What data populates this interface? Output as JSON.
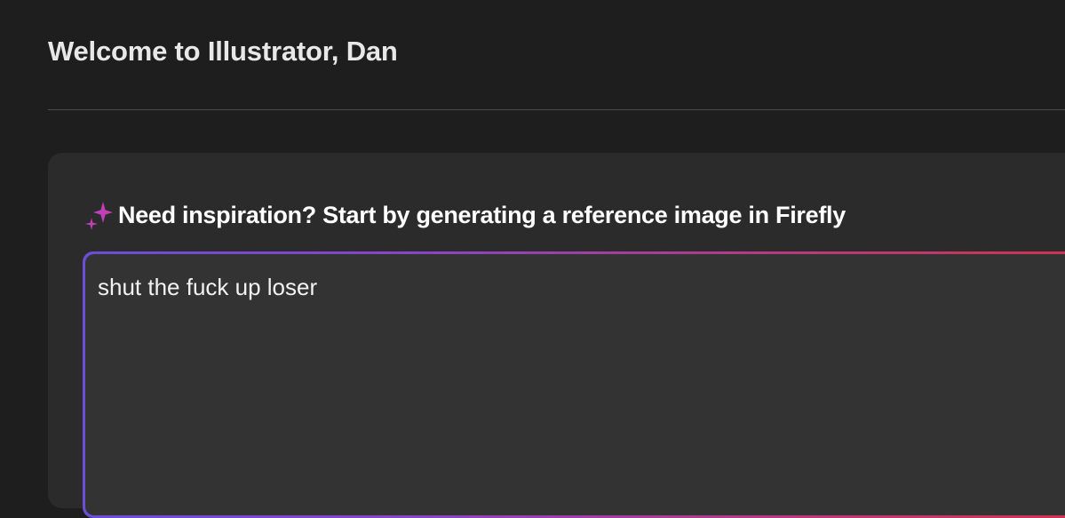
{
  "header": {
    "title": "Welcome to Illustrator, Dan"
  },
  "firefly_panel": {
    "icon": "sparkle-icon",
    "heading": "Need inspiration? Start by generating a reference image in Firefly",
    "prompt": {
      "value": "shut the fuck up loser"
    }
  },
  "colors": {
    "background": "#1e1e1e",
    "panel": "#2b2b2b",
    "input": "#333333",
    "gradient_start": "#6a4fd8",
    "gradient_end": "#d2334f",
    "sparkle_pink": "#e0339a",
    "sparkle_purple": "#a34ad6"
  }
}
